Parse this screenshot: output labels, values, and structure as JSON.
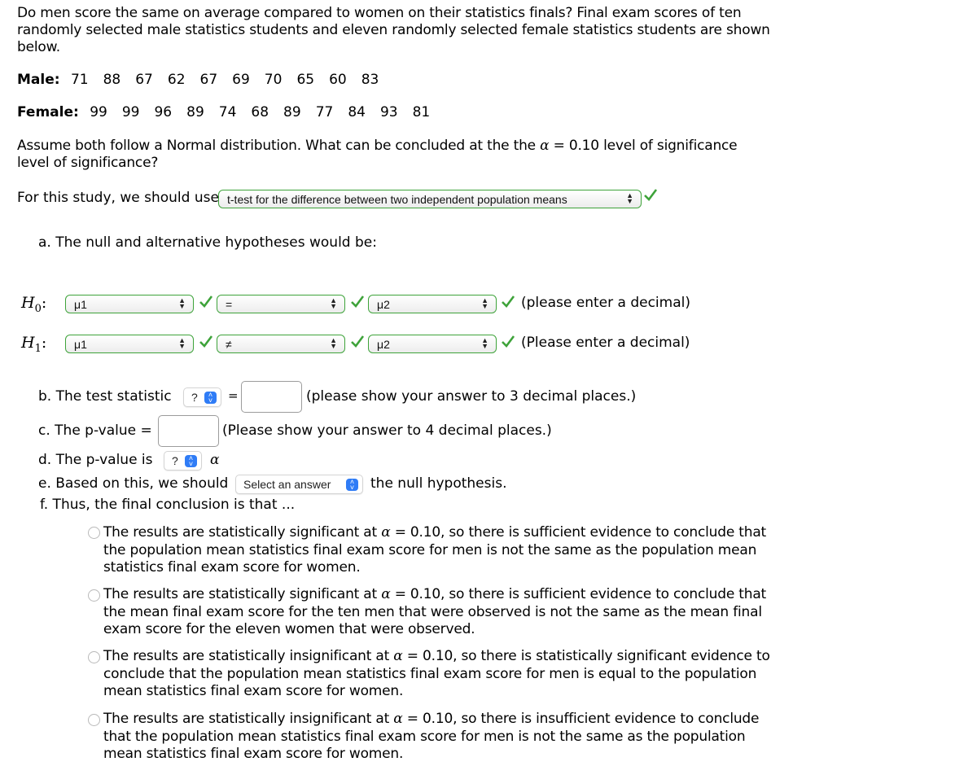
{
  "question": {
    "intro": "Do men score the same on average compared to women on their statistics finals? Final exam scores of ten randomly selected male statistics students and eleven randomly selected female statistics students are shown below.",
    "male_label": "Male:",
    "male_scores": [
      "71",
      "88",
      "67",
      "62",
      "67",
      "69",
      "70",
      "65",
      "60",
      "83"
    ],
    "female_label": "Female:",
    "female_scores": [
      "99",
      "99",
      "96",
      "89",
      "74",
      "68",
      "89",
      "77",
      "84",
      "93",
      "81"
    ],
    "assume_text_1": "Assume both follow a Normal distribution.  What can be concluded at the the ",
    "alpha_symbol": "α",
    "assume_text_2": " = 0.10 level of significance",
    "assume_text_3": "level of significance?"
  },
  "study": {
    "label": "For this study, we should use",
    "selected": "t-test for the difference between two independent population means",
    "correct": true
  },
  "part_a": {
    "label": "a.  The null and alternative hypotheses would be:",
    "h0": {
      "symbol": "H",
      "subscript": "0",
      "colon": ":",
      "left": "μ1",
      "operator": "=",
      "right": "μ2",
      "note": "(please enter a decimal)"
    },
    "h1": {
      "symbol": "H",
      "subscript": "1",
      "colon": ":",
      "left": "μ1",
      "operator": "≠",
      "right": "μ2",
      "note": "(Please enter a decimal)"
    }
  },
  "part_b": {
    "label": "b.  The test statistic",
    "select_value": "?",
    "equals": "=",
    "value": "",
    "note": "(please show your answer to 3 decimal places.)"
  },
  "part_c": {
    "label": "c.  The p-value =",
    "value": "",
    "note": "(Please show your answer to 4 decimal places.)"
  },
  "part_d": {
    "label": "d.  The p-value is",
    "select_value": "?",
    "alpha": "α"
  },
  "part_e": {
    "label": "e.  Based on this, we should",
    "select_value": "Select an answer",
    "suffix": "the null hypothesis."
  },
  "part_f": {
    "label": "f.  Thus, the final conclusion is that ...",
    "options": [
      {
        "pre": "The results are statistically significant at ",
        "alpha": "α",
        "post": " = 0.10, so there is sufficient evidence to conclude that the population mean statistics final exam score for men is not the same as the population mean statistics final exam score for women.",
        "selected": false
      },
      {
        "pre": "The results are statistically significant at ",
        "alpha": "α",
        "post": " = 0.10, so there is sufficient evidence to conclude that the mean final exam score for the ten men that were observed is not the same as the mean final exam score for the eleven women that were observed.",
        "selected": false
      },
      {
        "pre": "The results are statistically insignificant at ",
        "alpha": "α",
        "post": " = 0.10, so there is statistically significant evidence to conclude that the population mean statistics final exam score for men is equal to the population mean statistics final exam score for women.",
        "selected": false
      },
      {
        "pre": "The results are statistically insignificant at ",
        "alpha": "α",
        "post": " = 0.10, so there is insufficient evidence to conclude that the population mean statistics final exam score for men is not the same as the population mean statistics final exam score for women.",
        "selected": false
      }
    ]
  },
  "colors": {
    "correct_green": "#3ea33a",
    "select_blue": "#2f7cf6"
  }
}
